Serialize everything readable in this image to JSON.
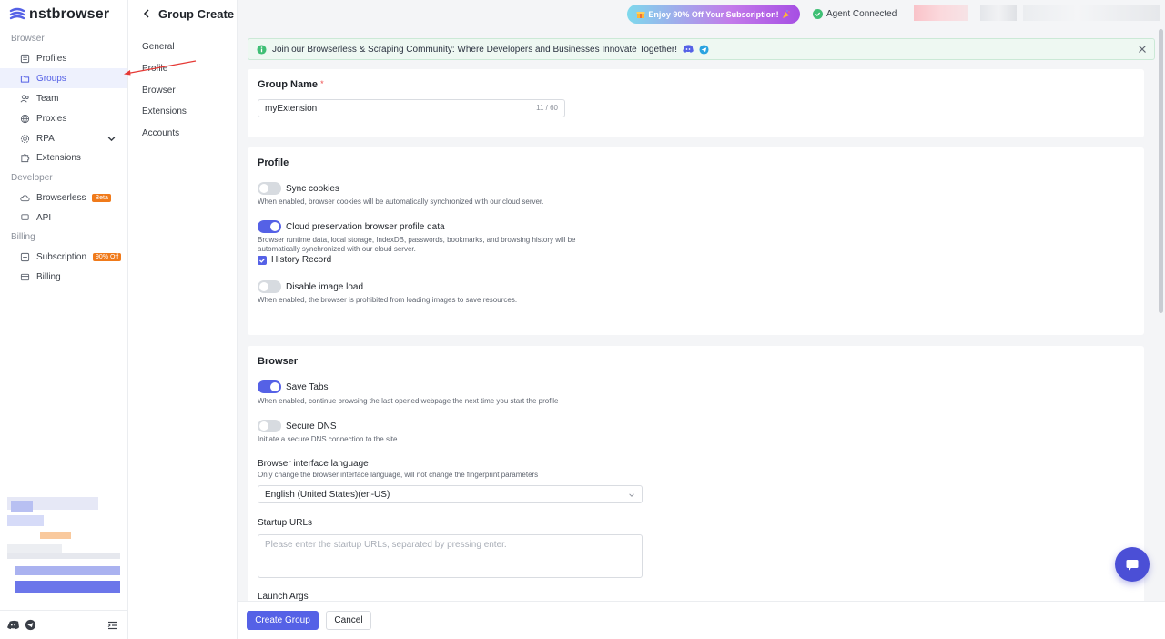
{
  "app": {
    "logo_text": "nstbrowser"
  },
  "sidebar": {
    "sections": {
      "browser": "Browser",
      "developer": "Developer",
      "billing": "Billing"
    },
    "items": [
      {
        "label": "Profiles",
        "icon": "profile-icon"
      },
      {
        "label": "Groups",
        "icon": "folder-icon"
      },
      {
        "label": "Team",
        "icon": "team-icon"
      },
      {
        "label": "Proxies",
        "icon": "globe-icon"
      },
      {
        "label": "RPA",
        "icon": "rpa-icon"
      },
      {
        "label": "Extensions",
        "icon": "puzzle-icon"
      },
      {
        "label": "Browserless",
        "icon": "cloud-icon",
        "badge": "Beta"
      },
      {
        "label": "API",
        "icon": "api-icon"
      },
      {
        "label": "Subscription",
        "icon": "subscription-icon",
        "badge": "90% Off"
      },
      {
        "label": "Billing",
        "icon": "billing-icon"
      }
    ]
  },
  "subnav": [
    "General",
    "Profile",
    "Browser",
    "Extensions",
    "Accounts"
  ],
  "header": {
    "title": "Group Create",
    "promo": "Enjoy 90% Off Your Subscription!",
    "agent_status": "Agent Connected"
  },
  "banner": {
    "text": "Join our Browserless & Scraping Community: Where Developers and Businesses Innovate Together!"
  },
  "group_name": {
    "label": "Group Name",
    "value": "myExtension",
    "counter": "11 / 60"
  },
  "profile": {
    "title": "Profile",
    "sync_cookies": {
      "label": "Sync cookies",
      "desc": "When enabled, browser cookies will be automatically synchronized with our cloud server.",
      "on": false
    },
    "cloud_preservation": {
      "label": "Cloud preservation browser profile data",
      "desc1": "Browser runtime data, local storage, IndexDB, passwords, bookmarks, and browsing history will be",
      "desc2": "automatically synchronized with our cloud server.",
      "on": true
    },
    "history_record": {
      "label": "History Record",
      "checked": true
    },
    "disable_image": {
      "label": "Disable image load",
      "desc": "When enabled, the browser is prohibited from loading images to save resources.",
      "on": false
    }
  },
  "browser": {
    "title": "Browser",
    "save_tabs": {
      "label": "Save Tabs",
      "desc": "When enabled, continue browsing the last opened webpage the next time you start the profile",
      "on": true
    },
    "secure_dns": {
      "label": "Secure DNS",
      "desc": "Initiate a secure DNS connection to the site",
      "on": false
    },
    "language": {
      "label": "Browser interface language",
      "desc": "Only change the browser interface language, will not change the fingerprint parameters",
      "value": "English (United States)(en-US)"
    },
    "startup_urls": {
      "label": "Startup URLs",
      "placeholder": "Please enter the startup URLs, separated by pressing enter."
    },
    "launch_args": {
      "label": "Launch Args"
    }
  },
  "footer": {
    "create": "Create Group",
    "cancel": "Cancel"
  },
  "colors": {
    "accent": "#5561e6",
    "badge": "#f07a1a",
    "success": "#3fbf75"
  }
}
